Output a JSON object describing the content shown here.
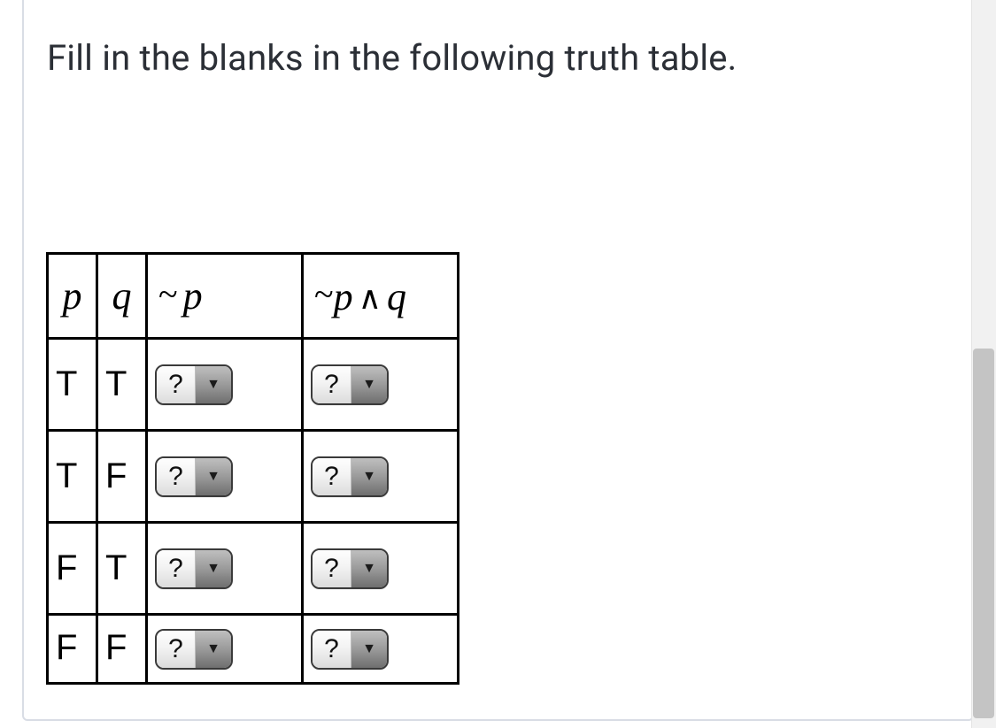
{
  "prompt": "Fill in the blanks in the following truth table.",
  "headers": {
    "p": "p",
    "q": "q",
    "not_p_tilde": "~",
    "not_p_var": "p",
    "conj_tilde": "~",
    "conj_p": "p",
    "conj_wedge": "∧",
    "conj_q": "q"
  },
  "rows": [
    {
      "p": "T",
      "q": "T",
      "not_p": "?",
      "conj": "?"
    },
    {
      "p": "T",
      "q": "F",
      "not_p": "?",
      "conj": "?"
    },
    {
      "p": "F",
      "q": "T",
      "not_p": "?",
      "conj": "?"
    },
    {
      "p": "F",
      "q": "F",
      "not_p": "?",
      "conj": "?"
    }
  ],
  "caret_glyph": "▼"
}
